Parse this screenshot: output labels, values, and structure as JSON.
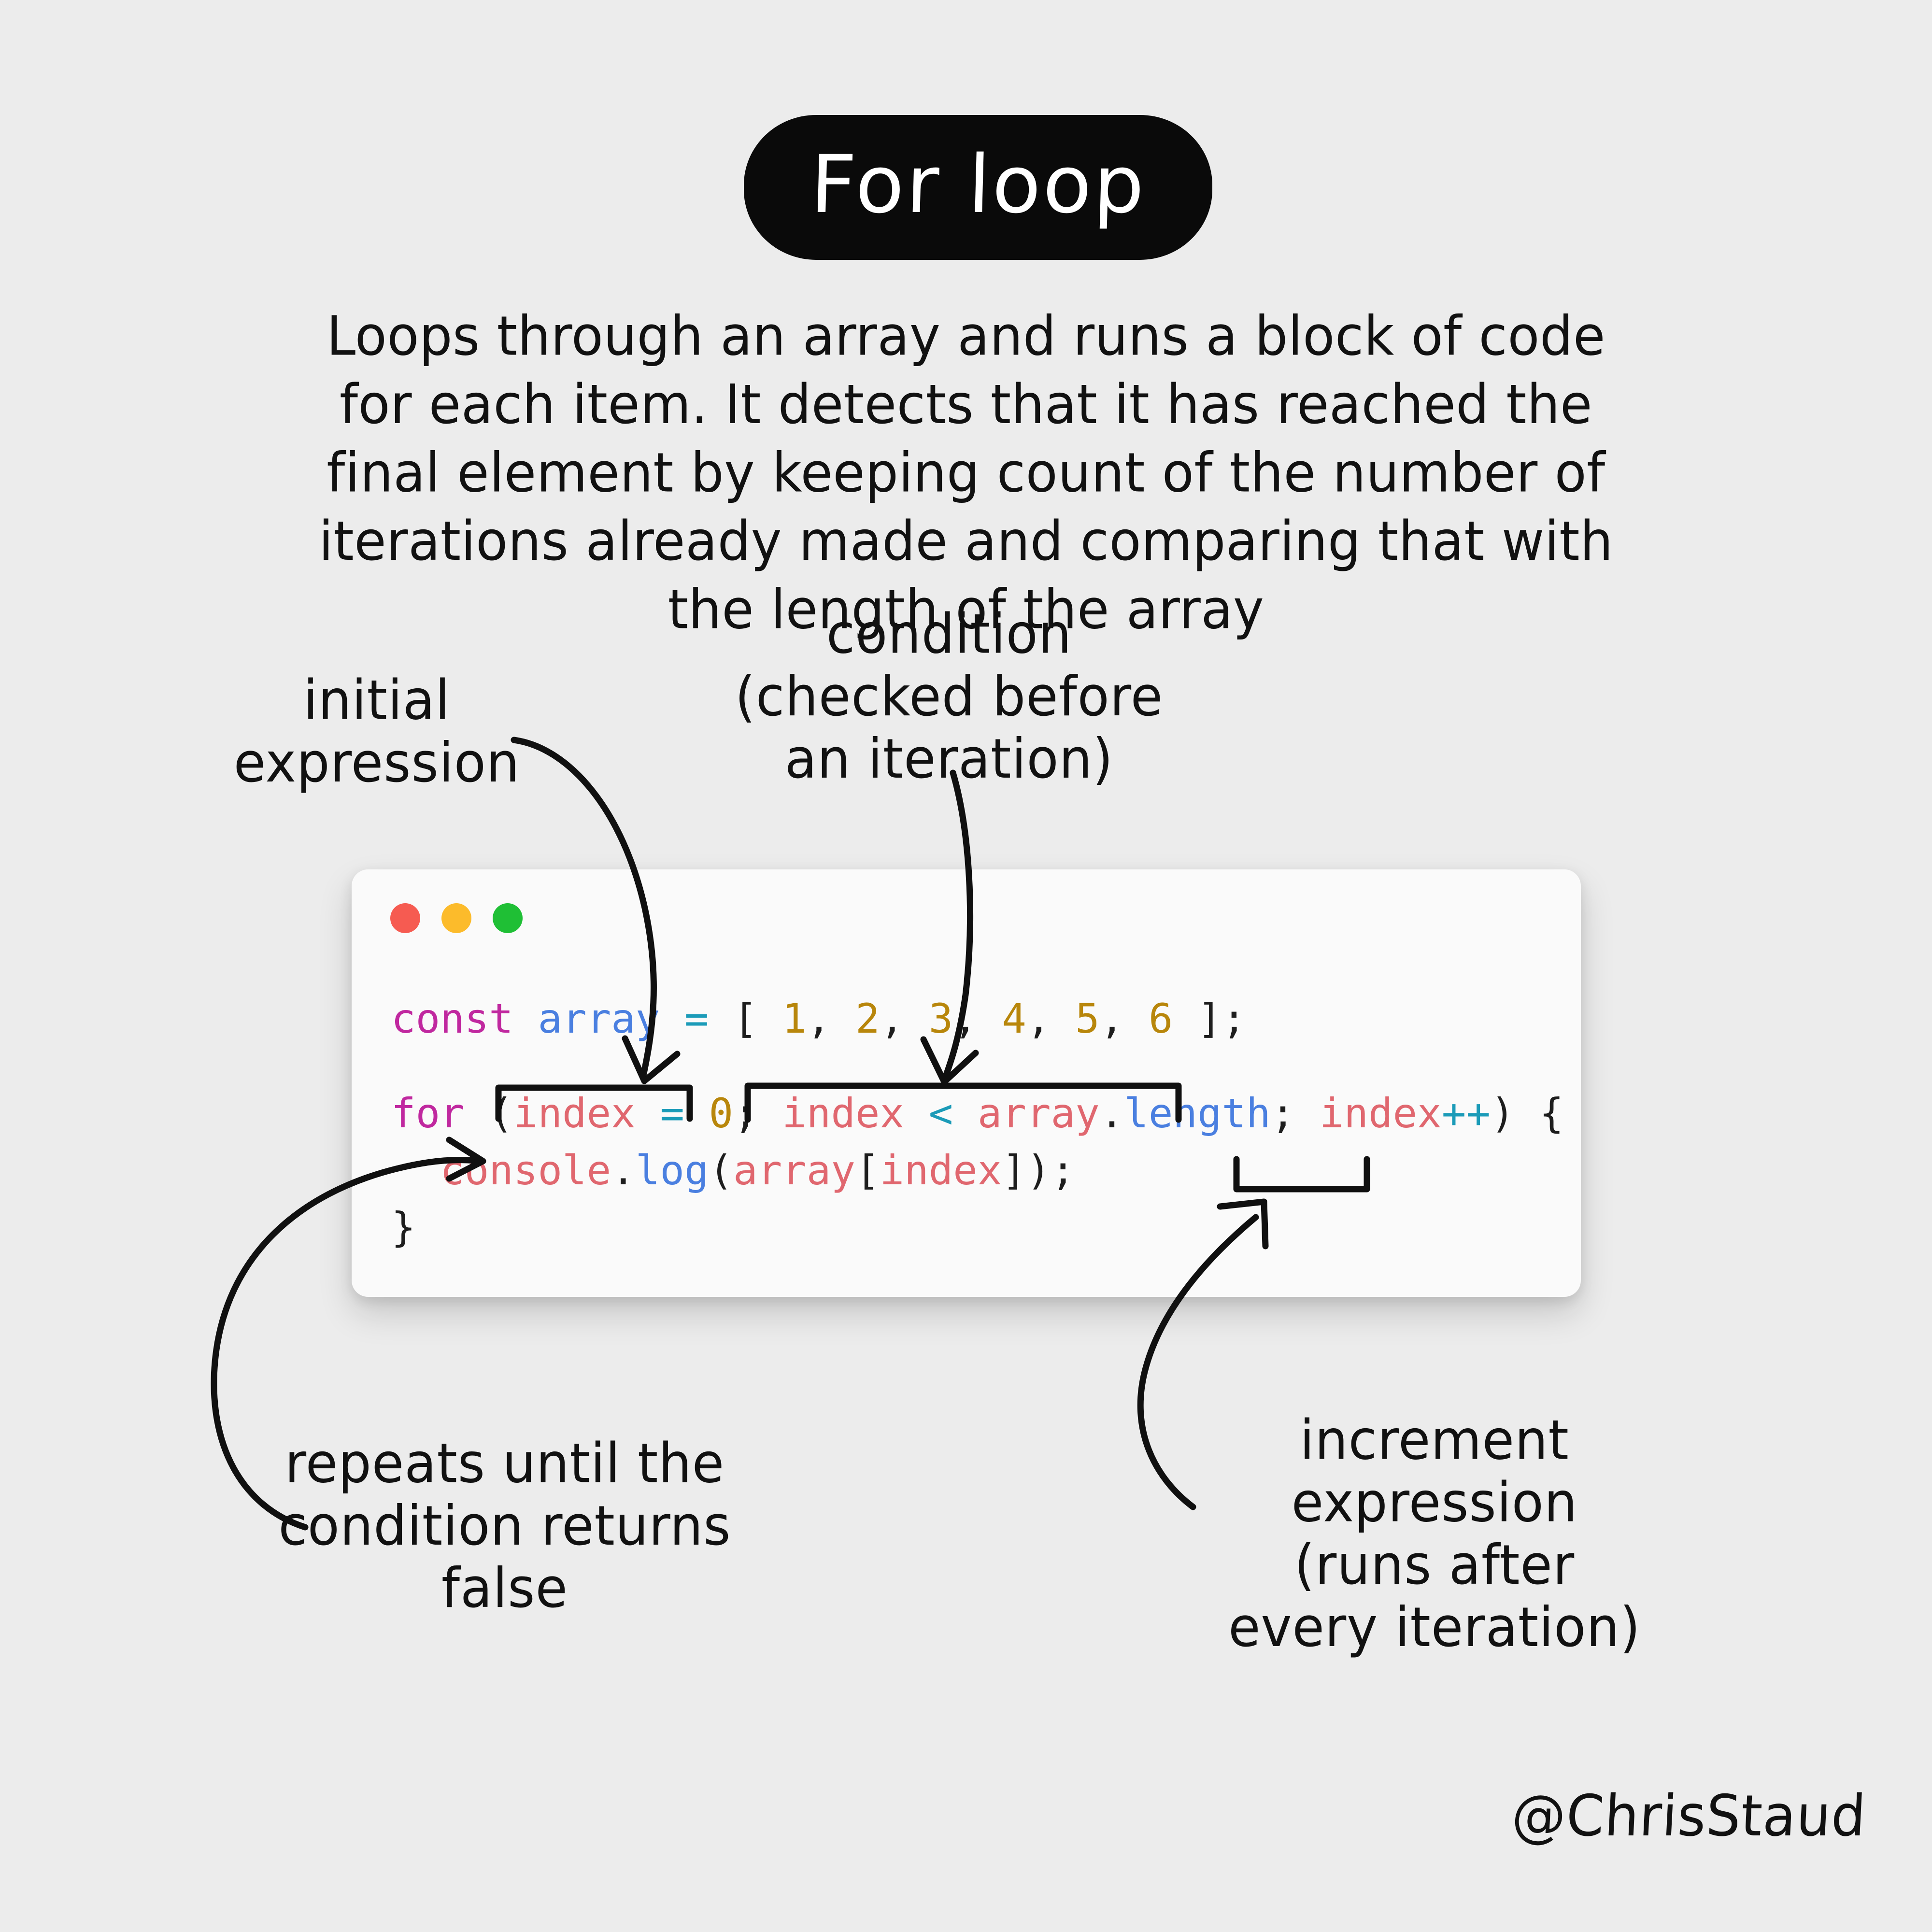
{
  "page": {
    "background_color": "#ececec",
    "signature": "@ChrisStaud"
  },
  "title": {
    "text": "For loop",
    "pill_color": "#0a0a0a",
    "text_color": "#ffffff"
  },
  "description": {
    "text": "Loops through an array and runs a block of code for each item. It detects that it has reached the final element by keeping count of the number of iterations already made and comparing that with the length of the array"
  },
  "code_window": {
    "background_color": "#fafafa",
    "traffic_lights": [
      {
        "name": "close",
        "color": "#f65b51"
      },
      {
        "name": "minimize",
        "color": "#fcbb2b"
      },
      {
        "name": "maximize",
        "color": "#1fbf35"
      }
    ],
    "lines": [
      {
        "id": "declaration",
        "plain": "const array = [ 1, 2, 3, 4, 5, 6 ];",
        "tokens": [
          {
            "t": "const",
            "c": "keyword"
          },
          {
            "t": " ",
            "c": "plain"
          },
          {
            "t": "array",
            "c": "function"
          },
          {
            "t": " ",
            "c": "plain"
          },
          {
            "t": "=",
            "c": "operator"
          },
          {
            "t": " ",
            "c": "plain"
          },
          {
            "t": "[",
            "c": "punct"
          },
          {
            "t": " ",
            "c": "plain"
          },
          {
            "t": "1",
            "c": "number"
          },
          {
            "t": ",",
            "c": "punct"
          },
          {
            "t": " ",
            "c": "plain"
          },
          {
            "t": "2",
            "c": "number"
          },
          {
            "t": ",",
            "c": "punct"
          },
          {
            "t": " ",
            "c": "plain"
          },
          {
            "t": "3",
            "c": "number"
          },
          {
            "t": ",",
            "c": "punct"
          },
          {
            "t": " ",
            "c": "plain"
          },
          {
            "t": "4",
            "c": "number"
          },
          {
            "t": ",",
            "c": "punct"
          },
          {
            "t": " ",
            "c": "plain"
          },
          {
            "t": "5",
            "c": "number"
          },
          {
            "t": ",",
            "c": "punct"
          },
          {
            "t": " ",
            "c": "plain"
          },
          {
            "t": "6",
            "c": "number"
          },
          {
            "t": " ",
            "c": "plain"
          },
          {
            "t": "];",
            "c": "punct"
          }
        ]
      },
      {
        "id": "blank",
        "plain": "",
        "tokens": []
      },
      {
        "id": "for-statement",
        "plain": "for (index = 0; index < array.length; index++) {",
        "tokens": [
          {
            "t": "for",
            "c": "keyword"
          },
          {
            "t": " (",
            "c": "punct"
          },
          {
            "t": "index",
            "c": "variable"
          },
          {
            "t": " ",
            "c": "plain"
          },
          {
            "t": "=",
            "c": "operator"
          },
          {
            "t": " ",
            "c": "plain"
          },
          {
            "t": "0",
            "c": "number"
          },
          {
            "t": "; ",
            "c": "punct"
          },
          {
            "t": "index",
            "c": "variable"
          },
          {
            "t": " ",
            "c": "plain"
          },
          {
            "t": "<",
            "c": "operator"
          },
          {
            "t": " ",
            "c": "plain"
          },
          {
            "t": "array",
            "c": "variable"
          },
          {
            "t": ".",
            "c": "punct"
          },
          {
            "t": "length",
            "c": "function"
          },
          {
            "t": "; ",
            "c": "punct"
          },
          {
            "t": "index",
            "c": "variable"
          },
          {
            "t": "++",
            "c": "operator"
          },
          {
            "t": ") {",
            "c": "punct"
          }
        ]
      },
      {
        "id": "console-log",
        "plain": "  console.log(array[index]);",
        "tokens": [
          {
            "t": "  ",
            "c": "plain"
          },
          {
            "t": "console",
            "c": "variable"
          },
          {
            "t": ".",
            "c": "punct"
          },
          {
            "t": "log",
            "c": "function"
          },
          {
            "t": "(",
            "c": "punct"
          },
          {
            "t": "array",
            "c": "variable"
          },
          {
            "t": "[",
            "c": "punct"
          },
          {
            "t": "index",
            "c": "variable"
          },
          {
            "t": "]);",
            "c": "punct"
          }
        ]
      },
      {
        "id": "closing-brace",
        "plain": "}",
        "tokens": [
          {
            "t": "}",
            "c": "punct"
          }
        ]
      }
    ],
    "syntax_colors": {
      "keyword": "#c0289f",
      "function": "#4a7fe0",
      "operator": "#1b9bb8",
      "number": "#b8860b",
      "punct": "#1d1d1d",
      "variable": "#e0676f"
    }
  },
  "annotations": [
    {
      "id": "initial",
      "text": "initial\nexpression",
      "target": "index = 0"
    },
    {
      "id": "condition",
      "text": "condition\n(checked before\nan iteration)",
      "target": "index < array.length"
    },
    {
      "id": "repeats",
      "text": "repeats until the\ncondition returns\nfalse",
      "target": "console.log(array[index]);"
    },
    {
      "id": "increment",
      "text": "increment\nexpression\n(runs after\nevery iteration)",
      "target": "index++"
    }
  ]
}
